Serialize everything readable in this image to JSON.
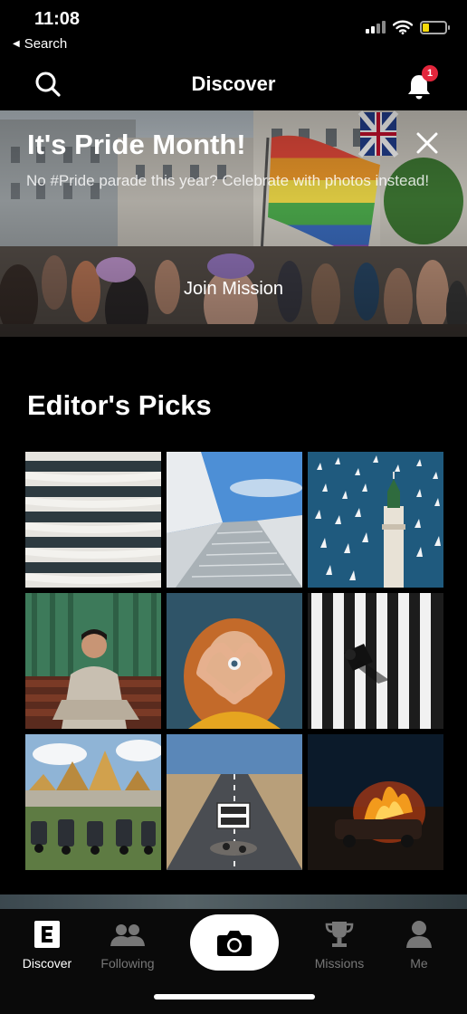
{
  "status_bar": {
    "time": "11:08",
    "back_label": "Search"
  },
  "header": {
    "title": "Discover",
    "notification_count": "1"
  },
  "banner": {
    "title": "It's Pride Month!",
    "description": "No #Pride parade this year? Celebrate with photos instead!",
    "cta_label": "Join Mission"
  },
  "editors_picks": {
    "title": "Editor's Picks",
    "photos": [
      "building-facade-photo",
      "white-staircase-photo",
      "sailboats-lighthouse-photo",
      "man-on-bench-photo",
      "woman-hands-heart-photo",
      "zebra-crossing-photo",
      "temple-scooters-photo",
      "road-closed-sign-photo",
      "burning-car-photo"
    ]
  },
  "tab_bar": {
    "items": [
      {
        "label": "Discover",
        "icon": "discover-icon",
        "active": true
      },
      {
        "label": "Following",
        "icon": "following-icon",
        "active": false
      },
      {
        "label": "",
        "icon": "camera-icon",
        "active": false
      },
      {
        "label": "Missions",
        "icon": "trophy-icon",
        "active": false
      },
      {
        "label": "Me",
        "icon": "profile-icon",
        "active": false
      }
    ]
  },
  "colors": {
    "badge": "#e3263c",
    "battery": "#f5d90a",
    "background": "#000000"
  }
}
